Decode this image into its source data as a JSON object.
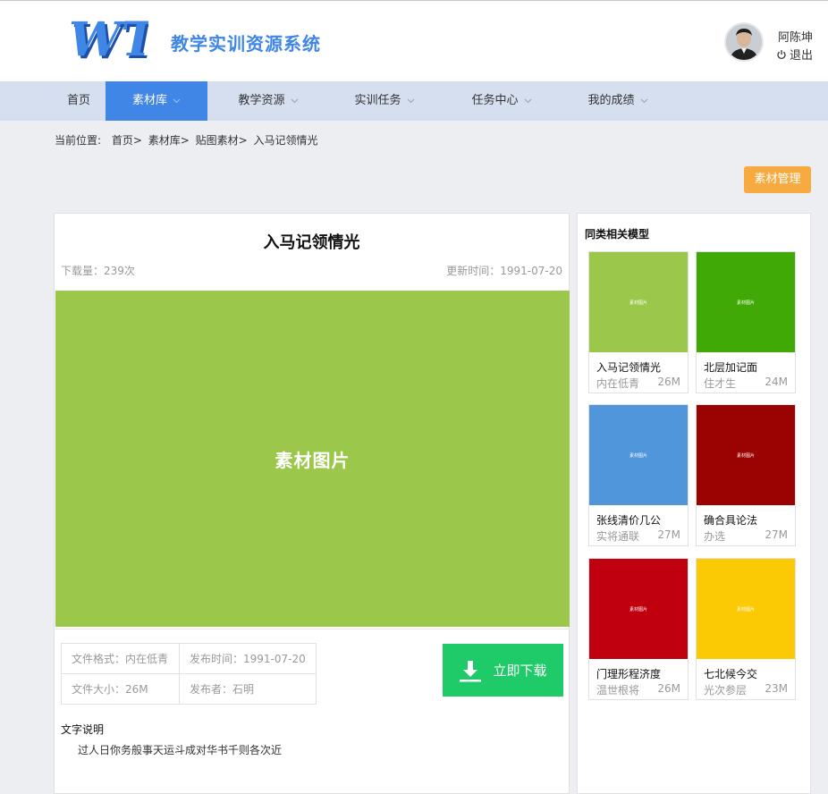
{
  "header": {
    "logo_text": "WT",
    "system_title": "教学实训资源系统",
    "username": "阿陈坤",
    "logout_label": "退出"
  },
  "nav": {
    "items": [
      {
        "label": "首页"
      },
      {
        "label": "素材库"
      },
      {
        "label": "教学资源"
      },
      {
        "label": "实训任务"
      },
      {
        "label": "任务中心"
      },
      {
        "label": "我的成绩"
      }
    ],
    "active_index": 1
  },
  "breadcrumb": {
    "prefix": "当前位置:",
    "items": [
      "首页>",
      "素材库>",
      "贴图素材>",
      "入马记领情光"
    ]
  },
  "manage_button": "素材管理",
  "material": {
    "title": "入马记领情光",
    "downloads": "下载量：239次",
    "updated": "更新时间：1991-07-20",
    "preview_label": "素材图片",
    "preview_color": "#9bc84b",
    "format": "文件格式：内在低青",
    "publish_time": "发布时间：1991-07-20",
    "size": "文件大小：26M",
    "publisher": "发布者：石明",
    "download_label": "立即下载",
    "description_title": "文字说明",
    "description": "过人日你务般事天运斗成对华书千则各次近"
  },
  "related": {
    "title": "同类相关模型",
    "thumb_label": "素材图片",
    "items": [
      {
        "name": "入马记领情光",
        "author": "内在低青",
        "size": "26M",
        "color": "#9bc84b"
      },
      {
        "name": "北层加记面",
        "author": "住才生",
        "size": "24M",
        "color": "#41a905"
      },
      {
        "name": "张线清价几公",
        "author": "实将通联",
        "size": "27M",
        "color": "#5096db"
      },
      {
        "name": "确合具论法",
        "author": "办选",
        "size": "27M",
        "color": "#9b0303"
      },
      {
        "name": "门理形程济度",
        "author": "温世根将",
        "size": "26M",
        "color": "#c1000f"
      },
      {
        "name": "七北候今交",
        "author": "光次参层",
        "size": "23M",
        "color": "#fbca05"
      }
    ]
  },
  "colors": {
    "primary": "#3f86e6",
    "nav_bg": "#d5dfef",
    "manage_button": "#f7aa40",
    "download_button": "#1fcb68"
  }
}
